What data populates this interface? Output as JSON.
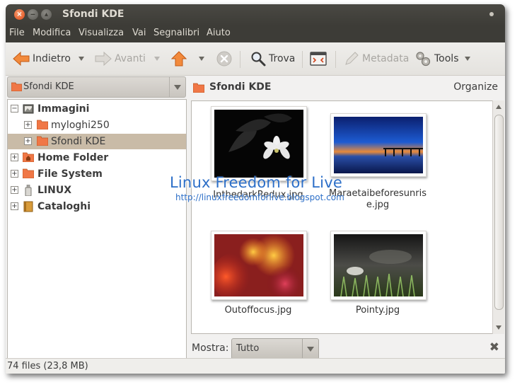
{
  "window": {
    "title": "Sfondi KDE"
  },
  "menubar": [
    "File",
    "Modifica",
    "Visualizza",
    "Vai",
    "Segnalibri",
    "Aiuto"
  ],
  "toolbar": {
    "back": "Indietro",
    "forward": "Avanti",
    "search": "Trova",
    "metadata": "Metadata",
    "tools": "Tools"
  },
  "sidebar": {
    "location": "Sfondi KDE",
    "tree": [
      {
        "label": "Immagini",
        "expander": "−"
      },
      {
        "label": "myloghi250",
        "expander": "+"
      },
      {
        "label": "Sfondi KDE",
        "expander": "+"
      },
      {
        "label": "Home Folder",
        "expander": "+"
      },
      {
        "label": "File System",
        "expander": "+"
      },
      {
        "label": "LINUX",
        "expander": "+"
      },
      {
        "label": "Cataloghi",
        "expander": "+"
      }
    ]
  },
  "content": {
    "title": "Sfondi KDE",
    "organize": "Organize",
    "files": [
      {
        "name": "InthedarkRedux.jpg",
        "thumb": "white-flower-dark"
      },
      {
        "name": "Maraetaibeforesunris e.jpg",
        "thumb": "pier-at-sunset"
      },
      {
        "name": "Outoffocus.jpg",
        "thumb": "blurred-lights"
      },
      {
        "name": "Pointy.jpg",
        "thumb": "macro-spikes"
      }
    ]
  },
  "watermark": {
    "title": "Linux Freedom for Live",
    "url": "http://linuxfreedomforlive.blogspot.com"
  },
  "filter": {
    "label": "Mostra:",
    "value": "Tutto"
  },
  "status": {
    "text": "74 files (23,8 MB)"
  },
  "colors": {
    "titlebar": "#3d3c37",
    "selection": "#c9bba7",
    "accent": "#f07746",
    "watermark": "#2d6fc8"
  }
}
